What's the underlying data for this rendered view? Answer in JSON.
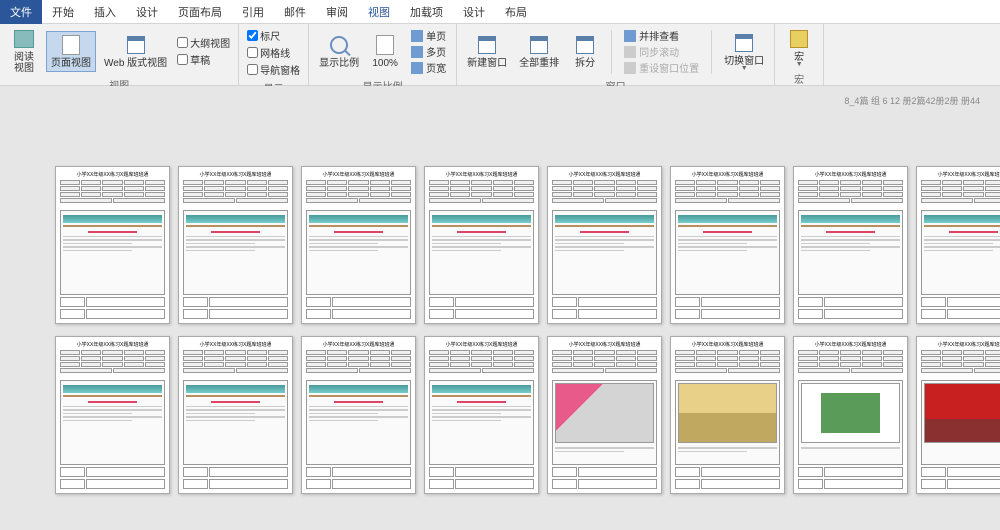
{
  "tabs": {
    "file": "文件",
    "items": [
      "开始",
      "插入",
      "设计",
      "页面布局",
      "引用",
      "邮件",
      "审阅",
      "视图",
      "加载项",
      "设计",
      "布局"
    ],
    "active_index": 7
  },
  "ribbon": {
    "views": {
      "read": "阅读\n视图",
      "page": "页面视图",
      "web": "Web 版式视图",
      "outline": "大纲视图",
      "draft": "草稿",
      "label": "视图"
    },
    "show": {
      "ruler": "标尺",
      "gridlines": "网格线",
      "nav": "导航窗格",
      "label": "显示"
    },
    "zoom": {
      "zoom": "显示比例",
      "hundred": "100%",
      "single": "单页",
      "multi": "多页",
      "width": "页宽",
      "label": "显示比例"
    },
    "window": {
      "new": "新建窗口",
      "all": "全部重排",
      "split": "拆分",
      "side": "并排查看",
      "sync": "同步滚动",
      "reset": "重设窗口位置",
      "switch": "切换窗口",
      "label": "窗口"
    },
    "macro": {
      "macro": "宏",
      "label": "宏"
    }
  },
  "status": "8_4篇   组 6 12 册2篇42册2册 册44",
  "thumb_title": "小学XX年级XX练习X题库班班通"
}
